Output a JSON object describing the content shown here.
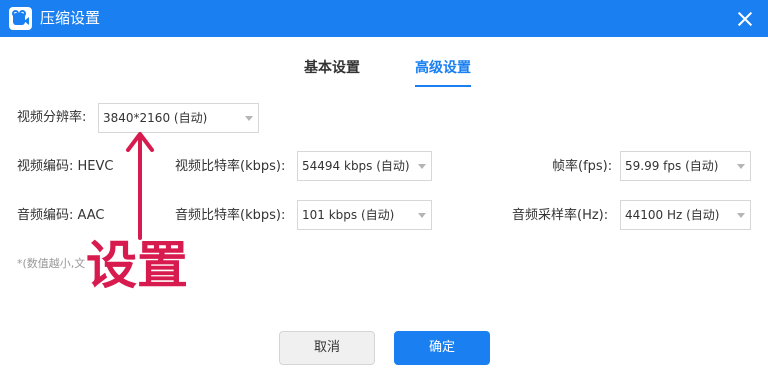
{
  "window": {
    "title": "压缩设置"
  },
  "tabs": [
    {
      "label": "基本设置",
      "active": false
    },
    {
      "label": "高级设置",
      "active": true
    }
  ],
  "settings": {
    "resolution": {
      "label": "视频分辨率:",
      "value": "3840*2160 (自动)"
    },
    "video_codec": {
      "label": "视频编码: HEVC"
    },
    "video_bitrate": {
      "label": "视频比特率(kbps):",
      "value": "54494 kbps (自动)"
    },
    "framerate": {
      "label": "帧率(fps):",
      "value": "59.99 fps (自动)"
    },
    "audio_codec": {
      "label": "音频编码: AAC"
    },
    "audio_bitrate": {
      "label": "音频比特率(kbps):",
      "value": "101 kbps (自动)"
    },
    "sample_rate": {
      "label": "音频采样率(Hz):",
      "value": "44100 Hz (自动)"
    }
  },
  "note": "*(数值越小,文",
  "annotation": {
    "text": "设置",
    "color": "#d81b4f"
  },
  "buttons": {
    "cancel": "取消",
    "confirm": "确定"
  },
  "colors": {
    "accent": "#1a7ff0",
    "titlebar": "#1a7ff0"
  }
}
